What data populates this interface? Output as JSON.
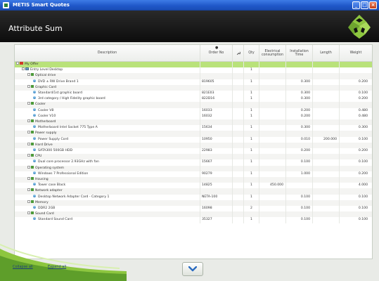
{
  "window": {
    "title": "METIS Smart Quotes",
    "controls": [
      "minimize-icon",
      "maximize-icon",
      "close-icon"
    ]
  },
  "header": {
    "title": "Attribute Sum"
  },
  "table": {
    "columns": [
      {
        "key": "desc",
        "label": "Description"
      },
      {
        "key": "order",
        "label": "Order No"
      },
      {
        "key": "wrench",
        "label": ""
      },
      {
        "key": "qty",
        "label": "Qty"
      },
      {
        "key": "elec",
        "label": "Electrical consumption"
      },
      {
        "key": "inst",
        "label": "Installation Time"
      },
      {
        "key": "len",
        "label": "Length"
      },
      {
        "key": "wt",
        "label": "Weight"
      }
    ],
    "rows": [
      {
        "type": "root",
        "indent": 0,
        "desc": "My Offer",
        "order": "",
        "qty": "",
        "elec": "",
        "inst": "",
        "len": "",
        "wt": ""
      },
      {
        "type": "group",
        "indent": 1,
        "desc": "Entry Level Desktop",
        "order": "",
        "qty": "1",
        "elec": "",
        "inst": "",
        "len": "",
        "wt": ""
      },
      {
        "type": "cat",
        "indent": 2,
        "desc": "Optical drive",
        "order": "",
        "qty": "",
        "elec": "",
        "inst": "",
        "len": "",
        "wt": ""
      },
      {
        "type": "item",
        "indent": 3,
        "desc": "DVD ± RW Drive Brand 1",
        "order": "819605",
        "qty": "1",
        "elec": "",
        "inst": "0.300",
        "len": "",
        "wt": "0.200"
      },
      {
        "type": "cat",
        "indent": 2,
        "desc": "Graphic Card",
        "order": "",
        "qty": "",
        "elec": "",
        "inst": "",
        "len": "",
        "wt": ""
      },
      {
        "type": "item",
        "indent": 3,
        "desc": "Standard/1st graphic board",
        "order": "821E03",
        "qty": "1",
        "elec": "",
        "inst": "0.300",
        "len": "",
        "wt": "0.100"
      },
      {
        "type": "item",
        "indent": 3,
        "desc": "3rd category / High Fidelity graphic board",
        "order": "822D16",
        "qty": "1",
        "elec": "",
        "inst": "0.300",
        "len": "",
        "wt": "0.200"
      },
      {
        "type": "cat",
        "indent": 2,
        "desc": "Cooler",
        "order": "",
        "qty": "",
        "elec": "",
        "inst": "",
        "len": "",
        "wt": ""
      },
      {
        "type": "item",
        "indent": 3,
        "desc": "Cooler V8",
        "order": "16033",
        "qty": "1",
        "elec": "",
        "inst": "0.200",
        "len": "",
        "wt": "0.480"
      },
      {
        "type": "item",
        "indent": 3,
        "desc": "Cooler V10",
        "order": "16032",
        "qty": "1",
        "elec": "",
        "inst": "0.200",
        "len": "",
        "wt": "0.480"
      },
      {
        "type": "cat",
        "indent": 2,
        "desc": "Motherboard",
        "order": "",
        "qty": "",
        "elec": "",
        "inst": "",
        "len": "",
        "wt": ""
      },
      {
        "type": "item",
        "indent": 3,
        "desc": "Motherboard Intel Socket 775 Type A",
        "order": "15634",
        "qty": "1",
        "elec": "",
        "inst": "0.300",
        "len": "",
        "wt": "0.300"
      },
      {
        "type": "cat",
        "indent": 2,
        "desc": "Power supply",
        "order": "",
        "qty": "",
        "elec": "",
        "inst": "",
        "len": "",
        "wt": ""
      },
      {
        "type": "item",
        "indent": 3,
        "desc": "Power Supply Cord",
        "order": "10950",
        "qty": "1",
        "elec": "",
        "inst": "0.010",
        "len": "200.000",
        "wt": "0.100"
      },
      {
        "type": "cat",
        "indent": 2,
        "desc": "Hard Drive",
        "order": "",
        "qty": "",
        "elec": "",
        "inst": "",
        "len": "",
        "wt": ""
      },
      {
        "type": "item",
        "indent": 3,
        "desc": "SATA300 500GB HDD",
        "order": "22983",
        "qty": "1",
        "elec": "",
        "inst": "0.200",
        "len": "",
        "wt": "0.200"
      },
      {
        "type": "cat",
        "indent": 2,
        "desc": "CPU",
        "order": "",
        "qty": "",
        "elec": "",
        "inst": "",
        "len": "",
        "wt": ""
      },
      {
        "type": "item",
        "indent": 3,
        "desc": "Dual core processor 2.93GHz with fan",
        "order": "15667",
        "qty": "1",
        "elec": "",
        "inst": "0.100",
        "len": "",
        "wt": "0.100"
      },
      {
        "type": "cat",
        "indent": 2,
        "desc": "Operating system",
        "order": "",
        "qty": "",
        "elec": "",
        "inst": "",
        "len": "",
        "wt": ""
      },
      {
        "type": "item",
        "indent": 3,
        "desc": "Windows 7 Professional Edition",
        "order": "90279",
        "qty": "1",
        "elec": "",
        "inst": "1.000",
        "len": "",
        "wt": "0.200"
      },
      {
        "type": "cat",
        "indent": 2,
        "desc": "Housing",
        "order": "",
        "qty": "",
        "elec": "",
        "inst": "",
        "len": "",
        "wt": ""
      },
      {
        "type": "item",
        "indent": 3,
        "desc": "Tower case Black",
        "order": "14825",
        "qty": "1",
        "elec": "450.000",
        "inst": "",
        "len": "",
        "wt": "4.000"
      },
      {
        "type": "cat",
        "indent": 2,
        "desc": "Network adapter",
        "order": "",
        "qty": "",
        "elec": "",
        "inst": "",
        "len": "",
        "wt": ""
      },
      {
        "type": "item",
        "indent": 3,
        "desc": "Desktop Network Adapter Card - Category 1",
        "order": "NETA-100",
        "qty": "1",
        "elec": "",
        "inst": "0.100",
        "len": "",
        "wt": "0.100"
      },
      {
        "type": "cat",
        "indent": 2,
        "desc": "Memory",
        "order": "",
        "qty": "",
        "elec": "",
        "inst": "",
        "len": "",
        "wt": ""
      },
      {
        "type": "item",
        "indent": 3,
        "desc": "DDR2 2GB",
        "order": "16098",
        "qty": "2",
        "elec": "",
        "inst": "0.100",
        "len": "",
        "wt": "0.100"
      },
      {
        "type": "cat",
        "indent": 2,
        "desc": "Sound Card",
        "order": "",
        "qty": "",
        "elec": "",
        "inst": "",
        "len": "",
        "wt": ""
      },
      {
        "type": "item",
        "indent": 3,
        "desc": "Standard Sound Card",
        "order": "35327",
        "qty": "1",
        "elec": "",
        "inst": "0.100",
        "len": "",
        "wt": "0.100"
      }
    ]
  },
  "footer": {
    "collapse_all": "Collapse all",
    "expand_all": "Expand all",
    "next_icon": "chevron-down-icon"
  },
  "colors": {
    "root_row": "#b9e27a",
    "header_bg": "#111111",
    "accent_green": "#8dc63f"
  }
}
